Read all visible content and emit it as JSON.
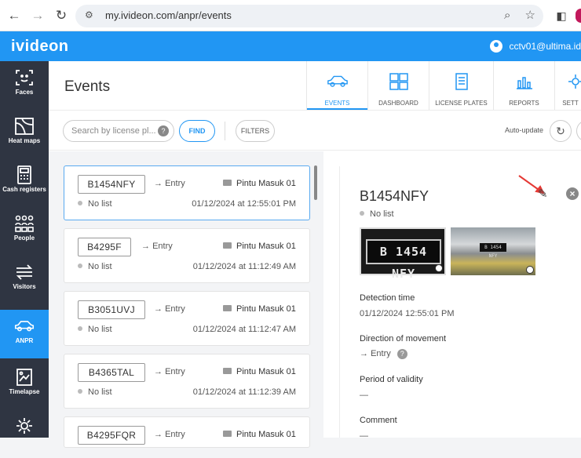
{
  "browser": {
    "url": "my.ivideon.com/anpr/events"
  },
  "app": {
    "logo": "ivideon",
    "user_email": "cctv01@ultima.id"
  },
  "sidebar": {
    "items": [
      {
        "label": "Faces",
        "icon": "face-scan-icon",
        "active": false
      },
      {
        "label": "Heat maps",
        "icon": "heatmap-icon",
        "active": false
      },
      {
        "label": "Cash registers",
        "icon": "calculator-icon",
        "active": false
      },
      {
        "label": "People",
        "icon": "people-grid-icon",
        "active": false
      },
      {
        "label": "Visitors",
        "icon": "visitors-arrows-icon",
        "active": false
      },
      {
        "label": "ANPR",
        "icon": "car-icon",
        "active": true
      },
      {
        "label": "Timelapse",
        "icon": "timelapse-icon",
        "active": false
      },
      {
        "label": "",
        "icon": "gear-icon",
        "active": false
      }
    ]
  },
  "page": {
    "title": "Events"
  },
  "tabs": [
    {
      "label": "EVENTS",
      "icon": "car-icon",
      "active": true
    },
    {
      "label": "DASHBOARD",
      "icon": "dashboard-icon",
      "active": false
    },
    {
      "label": "LICENSE PLATES",
      "icon": "document-icon",
      "active": false
    },
    {
      "label": "REPORTS",
      "icon": "bar-chart-icon",
      "active": false
    },
    {
      "label": "SETT",
      "icon": "gear-icon",
      "active": false
    }
  ],
  "toolbar": {
    "search_placeholder": "Search by license pl...",
    "help": "?",
    "find_label": "FIND",
    "filters_label": "FILTERS",
    "autoupdate_label": "Auto-update"
  },
  "events": [
    {
      "plate": "B1454NFY",
      "direction": "Entry",
      "camera": "Pintu Masuk 01",
      "list": "No list",
      "time": "01/12/2024 at 12:55:01 PM",
      "selected": true
    },
    {
      "plate": "B4295F",
      "direction": "Entry",
      "camera": "Pintu Masuk 01",
      "list": "No list",
      "time": "01/12/2024 at 11:12:49 AM",
      "selected": false
    },
    {
      "plate": "B3051UVJ",
      "direction": "Entry",
      "camera": "Pintu Masuk 01",
      "list": "No list",
      "time": "01/12/2024 at 11:12:47 AM",
      "selected": false
    },
    {
      "plate": "B4365TAL",
      "direction": "Entry",
      "camera": "Pintu Masuk 01",
      "list": "No list",
      "time": "01/12/2024 at 11:12:39 AM",
      "selected": false
    },
    {
      "plate": "B4295FQR",
      "direction": "Entry",
      "camera": "Pintu Masuk 01",
      "list": "",
      "time": "",
      "selected": false
    }
  ],
  "detail": {
    "plate": "B1454NFY",
    "list": "No list",
    "image_plate_text": "B 1454 NFY",
    "image2_plate_text": "B 1454 NFY",
    "detection_time_label": "Detection time",
    "detection_time": "01/12/2024 12:55:01 PM",
    "direction_label": "Direction of movement",
    "direction": "Entry",
    "direction_help": "?",
    "validity_label": "Period of validity",
    "validity": "—",
    "comment_label": "Comment",
    "comment": "—"
  }
}
